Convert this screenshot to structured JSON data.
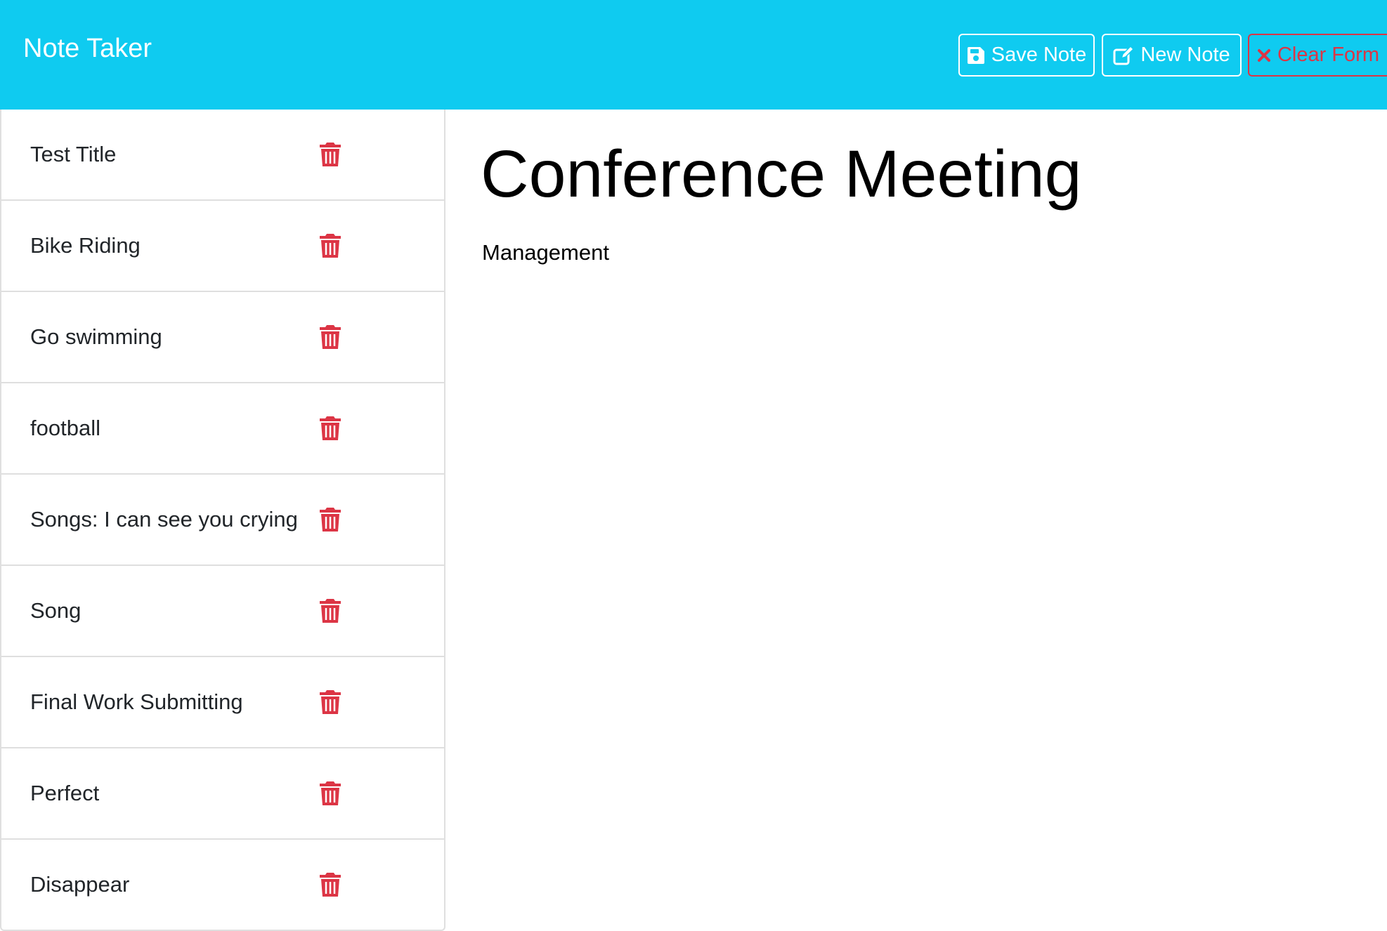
{
  "app": {
    "brand": "Note Taker"
  },
  "toolbar": {
    "save_label": "Save Note",
    "new_label": "New Note",
    "clear_label": "Clear Form"
  },
  "notes": [
    {
      "title": "Test Title"
    },
    {
      "title": "Bike Riding"
    },
    {
      "title": "Go swimming"
    },
    {
      "title": "football"
    },
    {
      "title": "Songs: I can see you crying"
    },
    {
      "title": "Song"
    },
    {
      "title": "Final Work Submitting"
    },
    {
      "title": "Perfect"
    },
    {
      "title": "Disappear"
    }
  ],
  "active_note": {
    "title": "Conference Meeting",
    "text": "Management"
  },
  "icons": {
    "save": "floppy-disk-icon",
    "new": "pen-to-square-icon",
    "clear": "x-mark-icon",
    "delete": "trash-icon"
  },
  "colors": {
    "navbar": "#0fcbf0",
    "danger": "#dc3545",
    "white": "#ffffff"
  }
}
